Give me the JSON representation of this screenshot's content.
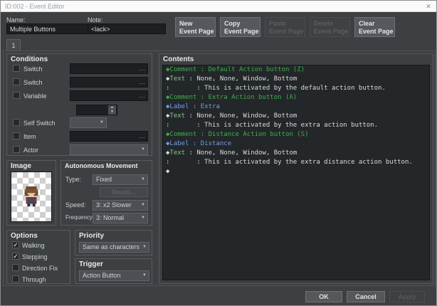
{
  "window": {
    "title": "ID:002 - Event Editor"
  },
  "icons": {
    "close": "✕",
    "dropdown_arrow": "▼",
    "spinner_up": "▲",
    "spinner_down": "▼",
    "ellipsis": "…",
    "check": "✓"
  },
  "header": {
    "name_label": "Name:",
    "name_value": "Multiple Buttons",
    "note_label": "Note:",
    "note_value": "<lack>",
    "buttons": [
      {
        "line1": "New",
        "line2": "Event Page",
        "enabled": true
      },
      {
        "line1": "Copy",
        "line2": "Event Page",
        "enabled": true
      },
      {
        "line1": "Paste",
        "line2": "Event Page",
        "enabled": false
      },
      {
        "line1": "Delete",
        "line2": "Event Page",
        "enabled": false
      },
      {
        "line1": "Clear",
        "line2": "Event Page",
        "enabled": true
      }
    ]
  },
  "page_tab": "1",
  "conditions": {
    "title": "Conditions",
    "rows": [
      {
        "label": "Switch",
        "mark": "",
        "value": ""
      },
      {
        "label": "Switch",
        "mark": "",
        "value": ""
      },
      {
        "label": "Variable",
        "mark": "",
        "value": ""
      }
    ],
    "spinner_value": "",
    "self_switch": {
      "label": "Self Switch",
      "mark": "",
      "value": ""
    },
    "item": {
      "label": "Item",
      "mark": "",
      "value": ""
    },
    "actor": {
      "label": "Actor",
      "mark": "",
      "value": ""
    }
  },
  "image_panel": {
    "title": "Image"
  },
  "movement": {
    "title": "Autonomous Movement",
    "type_label": "Type:",
    "type_value": "Fixed",
    "route_button": "Route...",
    "speed_label": "Speed:",
    "speed_value": "3: x2 Slower",
    "freq_label": "Frequency:",
    "freq_value": "3: Normal"
  },
  "options": {
    "title": "Options",
    "items": [
      {
        "label": "Walking",
        "mark": "✓"
      },
      {
        "label": "Stepping",
        "mark": "✓"
      },
      {
        "label": "Direction Fix",
        "mark": ""
      },
      {
        "label": "Through",
        "mark": ""
      }
    ]
  },
  "priority": {
    "title": "Priority",
    "value": "Same as characters"
  },
  "trigger": {
    "title": "Trigger",
    "value": "Action Button"
  },
  "contents": {
    "title": "Contents",
    "colors": {
      "comment": "#3fae4a",
      "label": "#6f9fe8",
      "command": "#8fc48f",
      "plain": "#d9dcde"
    },
    "lines": [
      {
        "segments": [
          {
            "text": "◆Comment : Default Action button (Z)",
            "color": "comment"
          }
        ]
      },
      {
        "segments": [
          {
            "text": "◆",
            "color": "plain"
          },
          {
            "text": "Text",
            "color": "command"
          },
          {
            "text": " : None, None, Window, Bottom",
            "color": "plain"
          }
        ]
      },
      {
        "segments": [
          {
            "text": ":       : This is activated by the default action button.",
            "color": "plain"
          }
        ]
      },
      {
        "segments": [
          {
            "text": "◆Comment : Extra Action button (A)",
            "color": "comment"
          }
        ]
      },
      {
        "segments": [
          {
            "text": "◆Label : Extra",
            "color": "label"
          }
        ]
      },
      {
        "segments": [
          {
            "text": "◆",
            "color": "plain"
          },
          {
            "text": "Text",
            "color": "command"
          },
          {
            "text": " : None, None, Window, Bottom",
            "color": "plain"
          }
        ]
      },
      {
        "segments": [
          {
            "text": ":       : This is activated by the extra action button.",
            "color": "plain"
          }
        ]
      },
      {
        "segments": [
          {
            "text": "◆Comment : Distance Action button (S)",
            "color": "comment"
          }
        ]
      },
      {
        "segments": [
          {
            "text": "◆Label : Distance",
            "color": "label"
          }
        ]
      },
      {
        "segments": [
          {
            "text": "◆",
            "color": "plain"
          },
          {
            "text": "Text",
            "color": "command"
          },
          {
            "text": " : None, None, Window, Bottom",
            "color": "plain"
          }
        ]
      },
      {
        "segments": [
          {
            "text": ":       : This is activated by the extra distance action button.",
            "color": "plain"
          }
        ]
      },
      {
        "segments": [
          {
            "text": "◆",
            "color": "plain"
          }
        ]
      }
    ]
  },
  "footer": {
    "ok": "OK",
    "cancel": "Cancel",
    "apply": "Apply"
  }
}
